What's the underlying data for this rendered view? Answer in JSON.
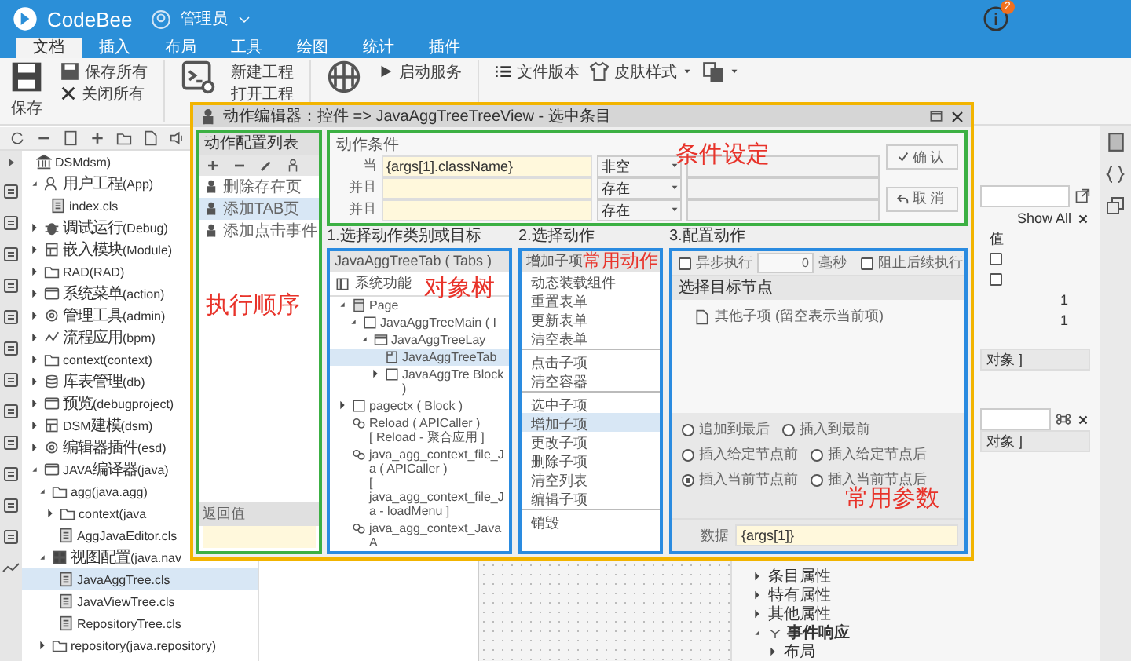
{
  "app": {
    "name": "CodeBee",
    "user": "管理员",
    "notification_count": "2"
  },
  "ribbon_tabs": [
    {
      "label": "文档",
      "selected": true
    },
    {
      "label": "插入",
      "selected": false
    },
    {
      "label": "布局",
      "selected": false
    },
    {
      "label": "工具",
      "selected": false
    },
    {
      "label": "绘图",
      "selected": false
    },
    {
      "label": "统计",
      "selected": false
    },
    {
      "label": "插件",
      "selected": false
    }
  ],
  "ribbon": {
    "save": "保存",
    "save_all": "保存所有",
    "close_all": "关闭所有",
    "new_project": "新建工程",
    "open_project": "打开工程",
    "start_service": "启动服务",
    "file_version": "文件版本",
    "skin_style": "皮肤样式"
  },
  "project_tree": [
    {
      "label": "DSMdsm)",
      "kind": "root",
      "selected": false,
      "children": [
        {
          "label": "用户工程(App)",
          "kind": "app",
          "expanded": true,
          "selected": false,
          "children": [
            {
              "label": "index.cls",
              "kind": "file",
              "selected": false
            }
          ]
        },
        {
          "label": "调试运行(Debug)",
          "kind": "bug",
          "expanded": false,
          "selected": false
        },
        {
          "label": "嵌入模块(Module)",
          "kind": "module",
          "expanded": false,
          "selected": false
        },
        {
          "label": "RAD(RAD)",
          "kind": "folder",
          "expanded": false,
          "selected": false
        },
        {
          "label": "系统菜单(action)",
          "kind": "window",
          "expanded": false,
          "selected": false
        },
        {
          "label": "管理工具(admin)",
          "kind": "gear",
          "expanded": false,
          "selected": false
        },
        {
          "label": "流程应用(bpm)",
          "kind": "flow",
          "expanded": false,
          "selected": false
        },
        {
          "label": "context(context)",
          "kind": "folder",
          "expanded": false,
          "selected": false
        },
        {
          "label": "库表管理(db)",
          "kind": "db",
          "expanded": false,
          "selected": false
        },
        {
          "label": "预览(debugproject)",
          "kind": "window",
          "expanded": false,
          "selected": false
        },
        {
          "label": "DSM建模(dsm)",
          "kind": "module",
          "expanded": false,
          "selected": false
        },
        {
          "label": "编辑器插件(esd)",
          "kind": "gear",
          "expanded": false,
          "selected": false
        },
        {
          "label": "JAVA编译器(java)",
          "kind": "window",
          "expanded": true,
          "selected": false,
          "children": [
            {
              "label": "agg(java.agg)",
              "kind": "folder",
              "expanded": true,
              "selected": false,
              "children": [
                {
                  "label": "context(java",
                  "kind": "folder",
                  "expanded": false,
                  "selected": false
                },
                {
                  "label": "AggJavaEditor.cls",
                  "kind": "file",
                  "selected": false
                }
              ]
            },
            {
              "label": "视图配置(java.nav",
              "kind": "grid",
              "expanded": true,
              "selected": false,
              "children": [
                {
                  "label": "JavaAggTree.cls",
                  "kind": "file",
                  "selected": true
                },
                {
                  "label": "JavaViewTree.cls",
                  "kind": "file",
                  "selected": false
                },
                {
                  "label": "RepositoryTree.cls",
                  "kind": "file",
                  "selected": false
                }
              ]
            },
            {
              "label": "repository(java.repository)",
              "kind": "folder",
              "expanded": false,
              "selected": false
            }
          ]
        }
      ]
    }
  ],
  "properties": {
    "show_all": "Show All",
    "value_header": "值",
    "checks": [
      {
        "checked": false
      },
      {
        "checked": false
      }
    ],
    "numbers": [
      "1",
      "1"
    ],
    "object_values": [
      "对象 ]",
      "对象 ]"
    ],
    "sections": [
      {
        "label": "条目属性",
        "expanded": false
      },
      {
        "label": "特有属性",
        "expanded": false
      },
      {
        "label": "其他属性",
        "expanded": false
      },
      {
        "label": "事件响应",
        "expanded": true,
        "children": [
          {
            "label": "布局",
            "expanded": false
          }
        ]
      }
    ]
  },
  "action_editor": {
    "title": "动作编辑器：控件 => JavaAggTreeTreeView - 选中条目",
    "action_list": {
      "title": "动作配置列表",
      "annotation": "执行顺序",
      "return_label": "返回值",
      "items": [
        {
          "label": "删除存在页",
          "selected": false
        },
        {
          "label": "添加TAB页",
          "selected": true
        },
        {
          "label": "添加点击事件",
          "selected": false
        }
      ]
    },
    "conditions": {
      "title": "动作条件",
      "annotation": "条件设定",
      "confirm": "确认",
      "cancel": "取消",
      "rows": [
        {
          "label": "当",
          "expression": "{args[1].className}",
          "operator": "非空"
        },
        {
          "label": "并且",
          "operator": "存在"
        },
        {
          "label": "并且",
          "operator": "存在"
        }
      ]
    },
    "step1": {
      "title": "1.选择动作类别或目标",
      "header": "JavaAggTreeTab ( Tabs )",
      "system": "系统功能",
      "annotation": "对象树",
      "nodes": [
        {
          "label": "Page",
          "kind": "page",
          "expanded": true,
          "selected": false,
          "children": [
            {
              "label": "JavaAggTreeMain ( I",
              "kind": "block",
              "expanded": true,
              "selected": false,
              "children": [
                {
                  "label": "JavaAggTreeLay",
                  "kind": "layout",
                  "expanded": true,
                  "selected": false,
                  "children": [
                    {
                      "label": "JavaAggTreeTab",
                      "kind": "tab",
                      "selected": true
                    },
                    {
                      "label": "JavaAggTre Block )",
                      "kind": "block",
                      "expanded": false,
                      "selected": false
                    }
                  ]
                }
              ]
            }
          ]
        },
        {
          "label": "pagectx ( Block )",
          "kind": "block",
          "expanded": false,
          "selected": false
        },
        {
          "label": "Reload ( APICaller )",
          "detail": "[ Reload - 聚合应用 ]",
          "kind": "api",
          "selected": false
        },
        {
          "label": "java_agg_context_file_Ja ( APICaller )",
          "detail": "[ java_agg_context_file_Ja - loadMenu ]",
          "kind": "api",
          "selected": false
        },
        {
          "label": "java_agg_context_JavaA",
          "kind": "api",
          "selected": false
        }
      ]
    },
    "step2": {
      "title": "2.选择动作",
      "header": "增加子项",
      "annotation": "常用动作",
      "groups": [
        [
          {
            "label": "动态装载组件",
            "selected": false
          },
          {
            "label": "重置表单",
            "selected": false
          },
          {
            "label": "更新表单",
            "selected": false
          },
          {
            "label": "清空表单",
            "selected": false
          }
        ],
        [
          {
            "label": "点击子项",
            "selected": false
          },
          {
            "label": "清空容器",
            "selected": false
          }
        ],
        [
          {
            "label": "选中子项",
            "selected": false
          },
          {
            "label": "增加子项",
            "selected": true
          },
          {
            "label": "更改子项",
            "selected": false
          },
          {
            "label": "删除子项",
            "selected": false
          },
          {
            "label": "清空列表",
            "selected": false
          },
          {
            "label": "编辑子项",
            "selected": false
          }
        ],
        [
          {
            "label": "销毁",
            "selected": false
          }
        ]
      ]
    },
    "step3": {
      "title": "3.配置动作",
      "async": {
        "label": "异步执行",
        "checked": false
      },
      "delay": "0",
      "delay_unit": "毫秒",
      "stop": {
        "label": "阻止后续执行",
        "checked": false
      },
      "target_title": "选择目标节点",
      "target_item": "其他子项 (留空表示当前项)",
      "annotation": "常用参数",
      "positions": [
        {
          "label": "追加到最后",
          "selected": false
        },
        {
          "label": "插入到最前",
          "selected": false
        },
        {
          "label": "插入给定节点前",
          "selected": false
        },
        {
          "label": "插入给定节点后",
          "selected": false
        },
        {
          "label": "插入当前节点前",
          "selected": true
        },
        {
          "label": "插入当前节点后",
          "selected": false
        }
      ],
      "data_label": "数据",
      "data_value": "{args[1]}"
    }
  }
}
